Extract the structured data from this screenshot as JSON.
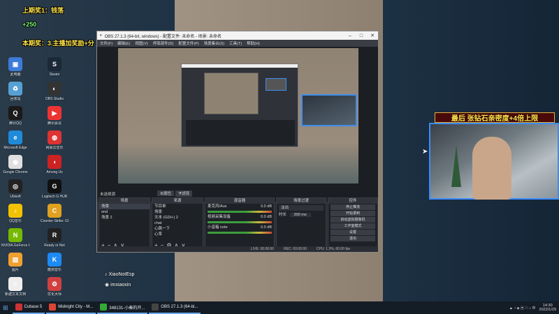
{
  "overlay": {
    "top_text_1": "上期奖1：钱荡",
    "top_text_2": "+250",
    "top_text_3": "本期奖：3.主播加奖励+分",
    "banner": "最后 张钻石亲密度+4倍上限",
    "watermark_1": "XiaoNotEsp",
    "watermark_2": "imxiaoxin"
  },
  "desktop_icons": [
    {
      "label": "此电脑",
      "color": "#3d7bd9",
      "glyph": "▣"
    },
    {
      "label": "回收站",
      "color": "#56a0d3",
      "glyph": "♻"
    },
    {
      "label": "腾讯QQ",
      "color": "#1a1a1a",
      "glyph": "Q"
    },
    {
      "label": "Microsoft Edge",
      "color": "#1f8ad8",
      "glyph": "e"
    },
    {
      "label": "Google Chrome",
      "color": "#e0e0e0",
      "glyph": "◉"
    },
    {
      "label": "Ubisoft",
      "color": "#222",
      "glyph": "◎"
    },
    {
      "label": "QQ音乐",
      "color": "#f2c200",
      "glyph": "♪"
    },
    {
      "label": "NVIDIA GeForce Experience",
      "color": "#76b900",
      "glyph": "N"
    },
    {
      "label": "图片",
      "color": "#f0a030",
      "glyph": "▤"
    },
    {
      "label": "新建文本文档",
      "color": "#eeeeee",
      "glyph": "≡"
    },
    {
      "label": "Steam",
      "color": "#1b2838",
      "glyph": "S"
    },
    {
      "label": "OBS Studio",
      "color": "#333",
      "glyph": "◐"
    },
    {
      "label": "腾讯会议",
      "color": "#e33",
      "glyph": "▶"
    },
    {
      "label": "网易云音乐",
      "color": "#d33",
      "glyph": "◍"
    },
    {
      "label": "Among Us",
      "color": "#c22",
      "glyph": "◖"
    },
    {
      "label": "Logitech G HUB",
      "color": "#111",
      "glyph": "G"
    },
    {
      "label": "Counter-Strike: Global Offensive",
      "color": "#e0a020",
      "glyph": "C"
    },
    {
      "label": "Ready or Not",
      "color": "#222",
      "glyph": "R"
    },
    {
      "label": "酷狗音乐",
      "color": "#1c8bf3",
      "glyph": "K"
    },
    {
      "label": "优化大师",
      "color": "#d04040",
      "glyph": "⚙"
    }
  ],
  "obs": {
    "title": "OBS 27.1.3 (64-bit, windows) - 配置文件: 未命名 - 场景: 未命名",
    "menu": [
      "文件(F)",
      "编辑(E)",
      "视图(V)",
      "停靠部件(D)",
      "配置文件(P)",
      "场景集合(S)",
      "工具(T)",
      "帮助(H)"
    ],
    "scene_label": "未选择源",
    "props_btn": "属性",
    "filters_btn": "滤镜",
    "scenes": {
      "header": "场景",
      "items": [
        "场景",
        "end",
        "场景 2"
      ]
    },
    "sources": {
      "header": "来源",
      "items": [
        "节目单",
        "场景",
        "文本 (GDI+) 2",
        "chat",
        "心跳一下",
        "心率"
      ]
    },
    "mixer": {
      "header": "混音器",
      "channels": [
        {
          "name": "麦克风/Aux",
          "level": "0.0 dB"
        },
        {
          "name": "视频采集设备",
          "level": "0.0 dB"
        },
        {
          "name": "小音箱 note",
          "level": "0.0 dB"
        }
      ]
    },
    "transitions": {
      "header": "场景过渡",
      "type": "淡出",
      "duration_label": "时长",
      "duration": "300 ms"
    },
    "controls": {
      "header": "控件",
      "buttons": [
        "停止推流",
        "开始录制",
        "启动虚拟摄像机",
        "工作室模式",
        "设置",
        "退出"
      ]
    },
    "status": {
      "live": "LIVE: 00:00:00",
      "rec": "REC: 00:00:00",
      "cpu": "CPU: 1.3%, 60.00 fps"
    }
  },
  "taskbar": {
    "items": [
      "Cubase 5",
      "Midnight City - M...",
      "348131-小秦的开...",
      "OBS 27.1.3 (64-bi..."
    ],
    "time": "14:30",
    "date": "2022/1/29"
  }
}
